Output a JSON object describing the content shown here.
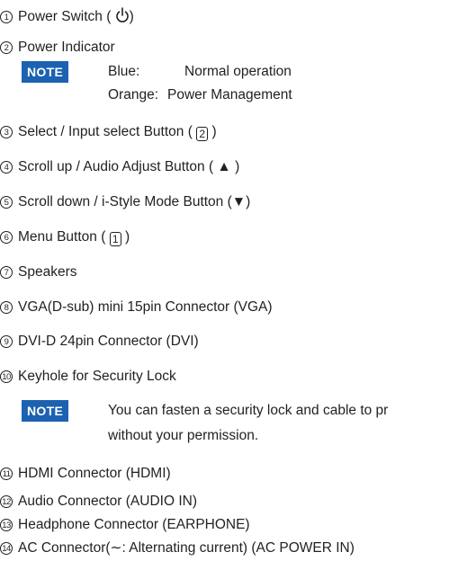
{
  "items": [
    {
      "num": "1",
      "pre": "Power Switch ( ",
      "symbol": "power-icon",
      "post": ")"
    },
    {
      "num": "2",
      "text": "Power Indicator"
    },
    {
      "num": "3",
      "pre": "Select / Input select Button ( ",
      "key": "2",
      "post": " )"
    },
    {
      "num": "4",
      "text": "Scroll up / Audio Adjust Button ( ▲ )"
    },
    {
      "num": "5",
      "text": "Scroll down / i-Style Mode Button (▼)"
    },
    {
      "num": "6",
      "pre": "Menu Button ( ",
      "key": "1",
      "post": " )"
    },
    {
      "num": "7",
      "text": "Speakers"
    },
    {
      "num": "8",
      "text": "VGA(D-sub) mini 15pin Connector (VGA)"
    },
    {
      "num": "9",
      "text": "DVI-D 24pin Connector (DVI)"
    },
    {
      "num": "10",
      "text": "Keyhole for Security Lock"
    },
    {
      "num": "11",
      "text": "HDMI Connector (HDMI)"
    },
    {
      "num": "12",
      "text": "Audio Connector (AUDIO IN)"
    },
    {
      "num": "13",
      "text": "Headphone Connector (EARPHONE)"
    },
    {
      "num": "14",
      "text": "AC Connector(∼: Alternating current) (AC POWER IN)"
    }
  ],
  "note1": {
    "label": "NOTE",
    "rows": [
      {
        "term": "Blue:",
        "desc": "Normal operation"
      },
      {
        "term": "Orange:",
        "desc": "Power Management"
      }
    ]
  },
  "note2": {
    "label": "NOTE",
    "line1": "You can fasten a security lock and cable to pr",
    "line2": "without your permission."
  },
  "colors": {
    "accent": "#1c62b0",
    "text": "#231f20"
  }
}
